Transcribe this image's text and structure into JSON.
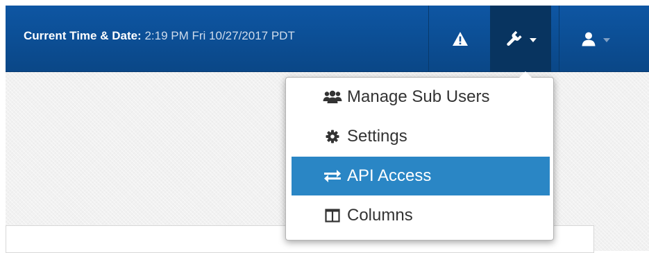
{
  "header": {
    "time_label": "Current Time & Date:",
    "time_value": "2:19 PM Fri 10/27/2017 PDT"
  },
  "nav": {
    "alerts_icon": "warning-icon",
    "tools_icon": "wrench-icon",
    "user_icon": "user-icon"
  },
  "menu": {
    "items": [
      {
        "label": "Manage Sub Users",
        "icon": "users-icon"
      },
      {
        "label": "Settings",
        "icon": "gear-icon"
      },
      {
        "label": "API Access",
        "icon": "exchange-arrows-icon",
        "highlighted": true
      },
      {
        "label": "Columns",
        "icon": "columns-icon"
      }
    ]
  },
  "colors": {
    "navbar": "#0e56a3",
    "active_button": "#083460",
    "highlight": "#2a86c5"
  }
}
